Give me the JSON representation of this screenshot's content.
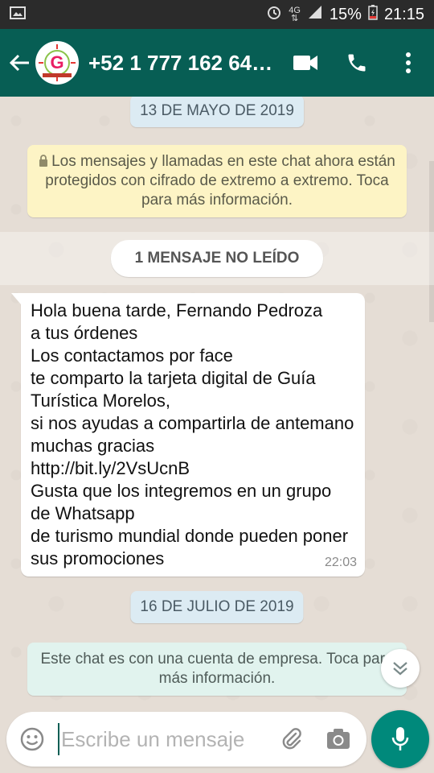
{
  "status_bar": {
    "network": "4G",
    "battery": "15%",
    "time": "21:15"
  },
  "header": {
    "contact_name": "+52 1 777 162 64…",
    "avatar_text": "G",
    "avatar_subtext": "GUÍA TURÍSTICA"
  },
  "chat": {
    "date_1": "13 DE MAYO DE 2019",
    "encryption_notice": "Los mensajes y llamadas en este chat ahora están protegidos con cifrado de extremo a extremo. Toca para más información.",
    "unread_label": "1 MENSAJE NO LEÍDO",
    "message": {
      "text": "Hola buena tarde, Fernando Pedroza\na tus órdenes\nLos contactamos por face\nte comparto la tarjeta digital de Guía Turística Morelos,\nsi nos ayudas a compartirla de antemano muchas gracias\nhttp://bit.ly/2VsUcnB\nGusta que los integremos en un grupo de Whatsapp\nde turismo mundial donde pueden poner sus promociones",
      "time": "22:03"
    },
    "date_2": "16 DE JULIO DE 2019",
    "business_notice": "Este chat es con una cuenta de empresa. Toca para más información."
  },
  "composer": {
    "placeholder": "Escribe un mensaje"
  },
  "colors": {
    "appbar": "#075e54",
    "statusbar": "#2b2b2b",
    "chat_bg": "#e5ddd5",
    "mic_button": "#00897b",
    "notice_yellow": "#fdf4c5",
    "notice_green": "#e1f3ee",
    "date_pill": "#dcebf3"
  },
  "icons": {
    "status_left": "image-icon",
    "alarm": "alarm-icon",
    "data": "data-arrows-icon",
    "signal": "signal-icon",
    "battery": "battery-icon",
    "back": "back-arrow-icon",
    "video": "video-call-icon",
    "call": "phone-icon",
    "menu": "more-vert-icon",
    "lock": "lock-icon",
    "scroll": "chevron-double-down-icon",
    "emoji": "emoji-icon",
    "attach": "paperclip-icon",
    "camera": "camera-icon",
    "mic": "mic-icon"
  }
}
